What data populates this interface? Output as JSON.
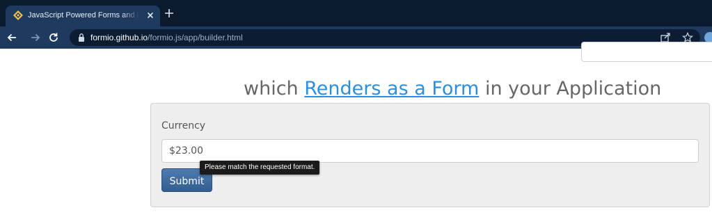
{
  "browser": {
    "tab": {
      "title": "JavaScript Powered Forms and Form.io",
      "favicon": "formio-logo-icon"
    },
    "url": {
      "host": "formio.github.io",
      "path": "/formio.js/app/builder.html"
    },
    "icons": [
      "back-icon",
      "forward-icon",
      "reload-icon",
      "lock-icon",
      "share-icon",
      "star-icon",
      "close-icon",
      "plus-icon"
    ]
  },
  "page": {
    "heading": {
      "prefix": "which ",
      "link": "Renders as a Form",
      "suffix": " in your Application"
    },
    "form": {
      "currency_label": "Currency",
      "currency_value": "$23.00",
      "submit_label": "Submit",
      "tooltip": "Please match the requested format."
    }
  },
  "colors": {
    "chrome_bg": "#1f3a5f",
    "link": "#2c8ee0",
    "button": "#3f6ea3"
  }
}
